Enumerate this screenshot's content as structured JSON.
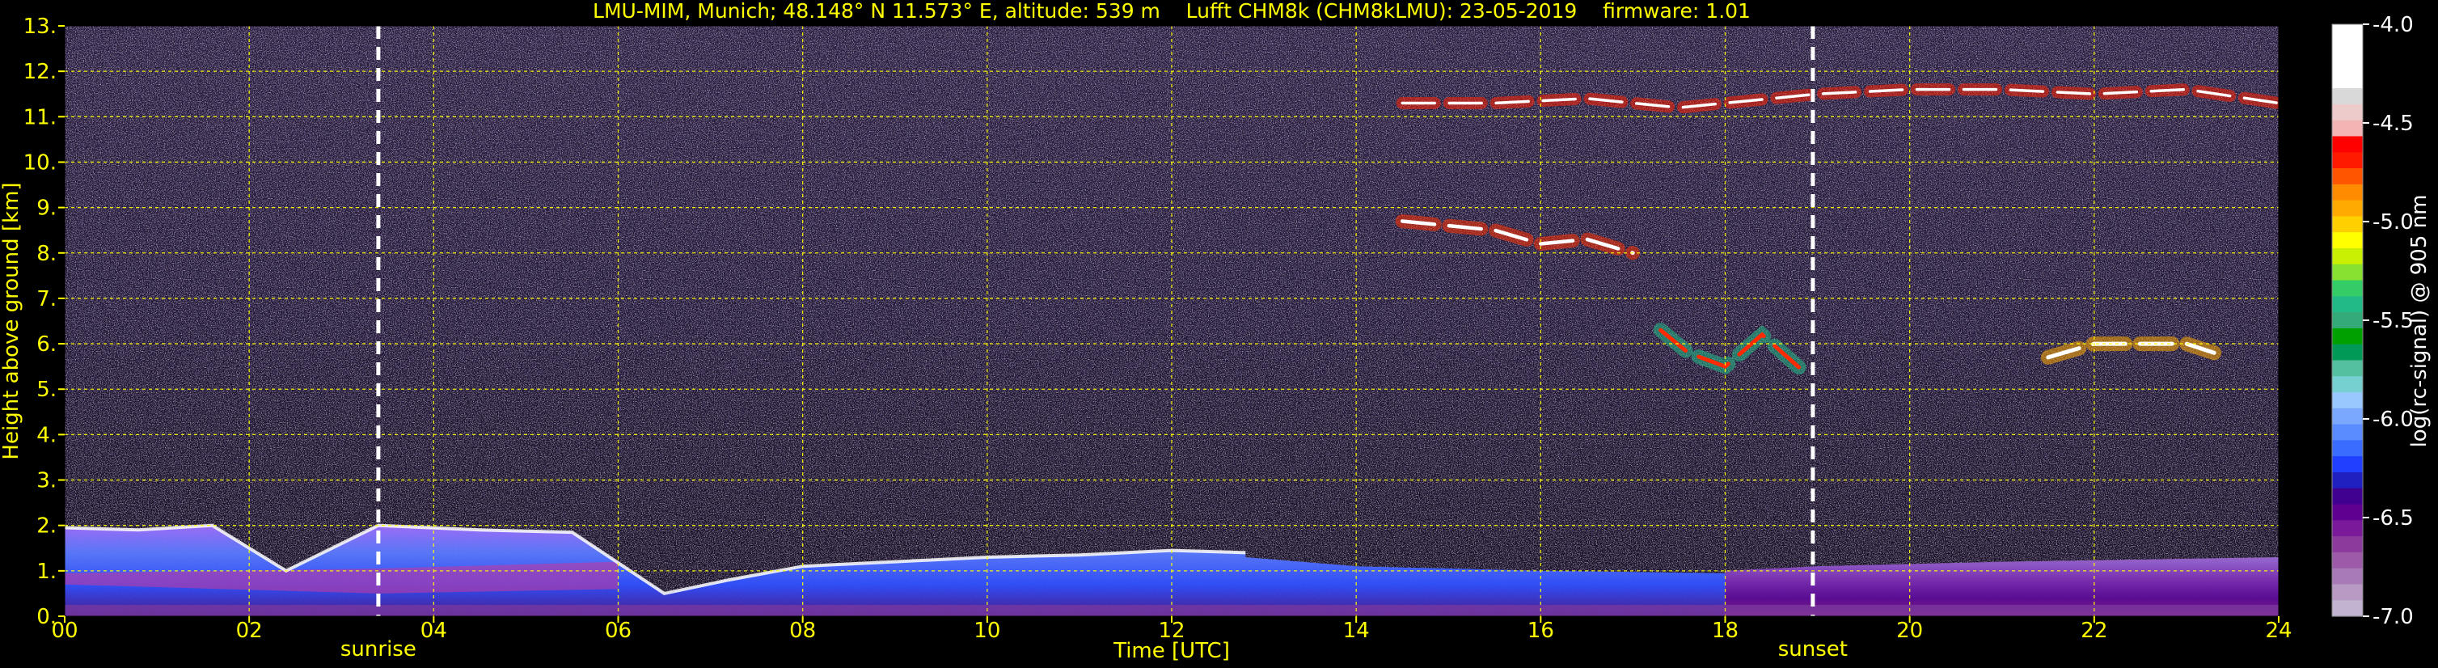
{
  "chart_data": {
    "type": "heatmap",
    "title": "LMU-MIM, Munich; 48.148° N 11.573° E, altitude: 539 m    Lufft CHM8k (CHM8kLMU): 23-05-2019    firmware: 1.01",
    "xlabel": "Time [UTC]",
    "ylabel": "Height above ground [km]",
    "xlim": [
      0,
      24
    ],
    "ylim": [
      0,
      13
    ],
    "x_ticks": [
      "00",
      "02",
      "04",
      "06",
      "08",
      "10",
      "12",
      "14",
      "16",
      "18",
      "20",
      "22",
      "24"
    ],
    "y_ticks": [
      "0.",
      "1.",
      "2.",
      "3.",
      "4.",
      "5.",
      "6.",
      "7.",
      "8.",
      "9.",
      "10.",
      "11.",
      "12.",
      "13."
    ],
    "grid": true,
    "events": [
      {
        "label": "sunrise",
        "time": 3.4
      },
      {
        "label": "sunset",
        "time": 18.95
      }
    ],
    "colorbar": {
      "label": "log(rc-signal) @ 905 nm",
      "range": [
        -7.0,
        -4.0
      ],
      "ticks": [
        "-4.0",
        "-4.5",
        "-5.0",
        "-5.5",
        "-6.0",
        "-6.5",
        "-7.0"
      ],
      "colors": [
        "#ffffff",
        "#ffffff",
        "#ffffff",
        "#ffffff",
        "#d9d9d9",
        "#eecbcb",
        "#f3b4b4",
        "#ff0000",
        "#ff1a00",
        "#ff5500",
        "#ff8c00",
        "#ffaa00",
        "#ffd000",
        "#ffff00",
        "#c9f000",
        "#88e030",
        "#33cc66",
        "#22bb88",
        "#33aa77",
        "#00a000",
        "#009955",
        "#55c0a0",
        "#77d0d0",
        "#99c8ff",
        "#7aa8ff",
        "#5a8cff",
        "#3a6cff",
        "#2040ff",
        "#2020c0",
        "#400090",
        "#600090",
        "#7a1a9a",
        "#8c3a9c",
        "#9c5aa8",
        "#a87ab8",
        "#b89ac4",
        "#c0b4d0"
      ]
    },
    "features": [
      {
        "name": "boundary layer aerosol top (early)",
        "t": [
          0.0,
          0.8,
          1.6,
          2.4,
          3.4,
          4.5,
          5.5,
          6.5,
          7.2,
          8.0,
          9.0,
          10.0,
          11.0,
          12.0,
          12.8
        ],
        "h": [
          1.95,
          1.9,
          2.0,
          1.0,
          2.0,
          1.9,
          1.85,
          0.5,
          0.8,
          1.1,
          1.2,
          1.3,
          1.35,
          1.45,
          1.4
        ]
      },
      {
        "name": "cirrus 11 km",
        "t": [
          14.5,
          15.5,
          16.5,
          17.5,
          19.0,
          20.0,
          21.0,
          22.0,
          23.0,
          24.0
        ],
        "h": [
          11.3,
          11.3,
          11.4,
          11.2,
          11.5,
          11.6,
          11.6,
          11.5,
          11.6,
          11.3
        ]
      },
      {
        "name": "cloud 8 km",
        "t": [
          14.5,
          15.0,
          15.5,
          16.0,
          16.5,
          17.0
        ],
        "h": [
          8.7,
          8.6,
          8.5,
          8.2,
          8.3,
          8.0
        ]
      },
      {
        "name": "cloud 6 km",
        "t": [
          17.3,
          17.6,
          18.0,
          18.4,
          18.9
        ],
        "h": [
          6.3,
          5.8,
          5.5,
          6.2,
          5.3
        ]
      },
      {
        "name": "cloud 5.8 km late",
        "t": [
          21.5,
          22.0,
          22.5,
          23.0,
          23.3
        ],
        "h": [
          5.7,
          6.0,
          6.0,
          6.0,
          5.8
        ]
      }
    ]
  }
}
